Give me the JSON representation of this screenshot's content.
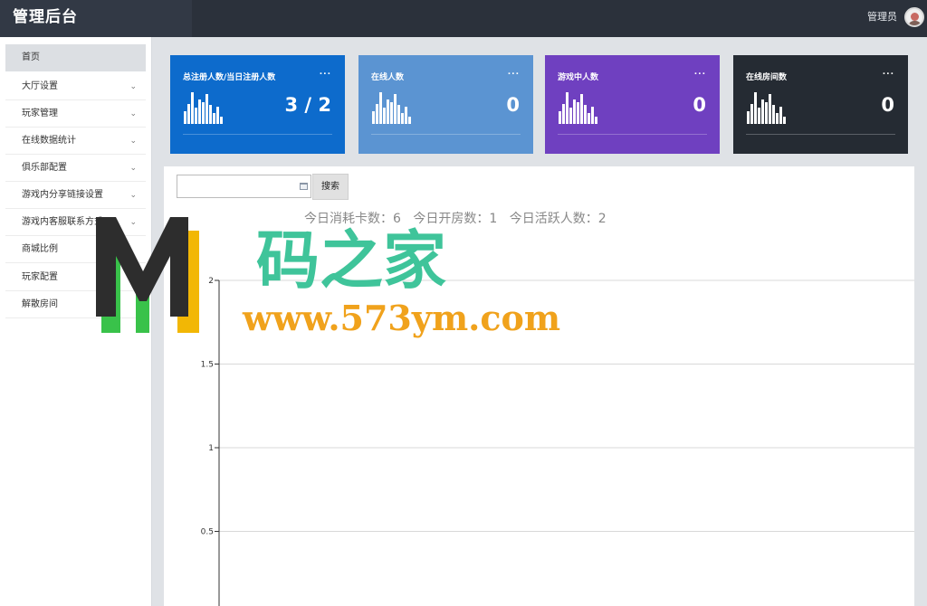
{
  "header": {
    "title": "管理后台",
    "user": "管理员",
    "colors": {
      "bar": "#2b313b",
      "brand": "#323945"
    }
  },
  "sidebar": {
    "items": [
      {
        "label": "首页",
        "active": true
      },
      {
        "label": "大厅设置",
        "has_children": true
      },
      {
        "label": "玩家管理",
        "has_children": true
      },
      {
        "label": "在线数据统计",
        "has_children": true
      },
      {
        "label": "俱乐部配置",
        "has_children": true
      },
      {
        "label": "游戏内分享链接设置",
        "has_children": true
      },
      {
        "label": "游戏内客服联系方式",
        "has_children": true
      },
      {
        "label": "商城比例"
      },
      {
        "label": "玩家配置"
      },
      {
        "label": "解散房间"
      }
    ]
  },
  "stats": [
    {
      "title": "总注册人数/当日注册人数",
      "value": "3 / 2",
      "menu": "...",
      "color": "#0d6bcc"
    },
    {
      "title": "在线人数",
      "value": "0",
      "menu": "...",
      "color": "#5b94d2"
    },
    {
      "title": "游戏中人数",
      "value": "0",
      "menu": "...",
      "color": "#6f40c0"
    },
    {
      "title": "在线房间数",
      "value": "0",
      "menu": "...",
      "color": "#252b33"
    }
  ],
  "filter": {
    "date_value": "",
    "search_label": "搜索"
  },
  "summary": {
    "cards_used": "今日消耗卡数：6",
    "rooms_opened": "今日开房数：1",
    "active_users": "今日活跃人数：2"
  },
  "chart_data": {
    "type": "line",
    "yticks": [
      "2",
      "1.5",
      "1",
      "0.5"
    ],
    "ylim": [
      0,
      2
    ],
    "grid": true,
    "series": []
  },
  "watermark": {
    "logo_letter": "M",
    "text_cn": "码之家",
    "text_url": "www.573ym.com"
  }
}
